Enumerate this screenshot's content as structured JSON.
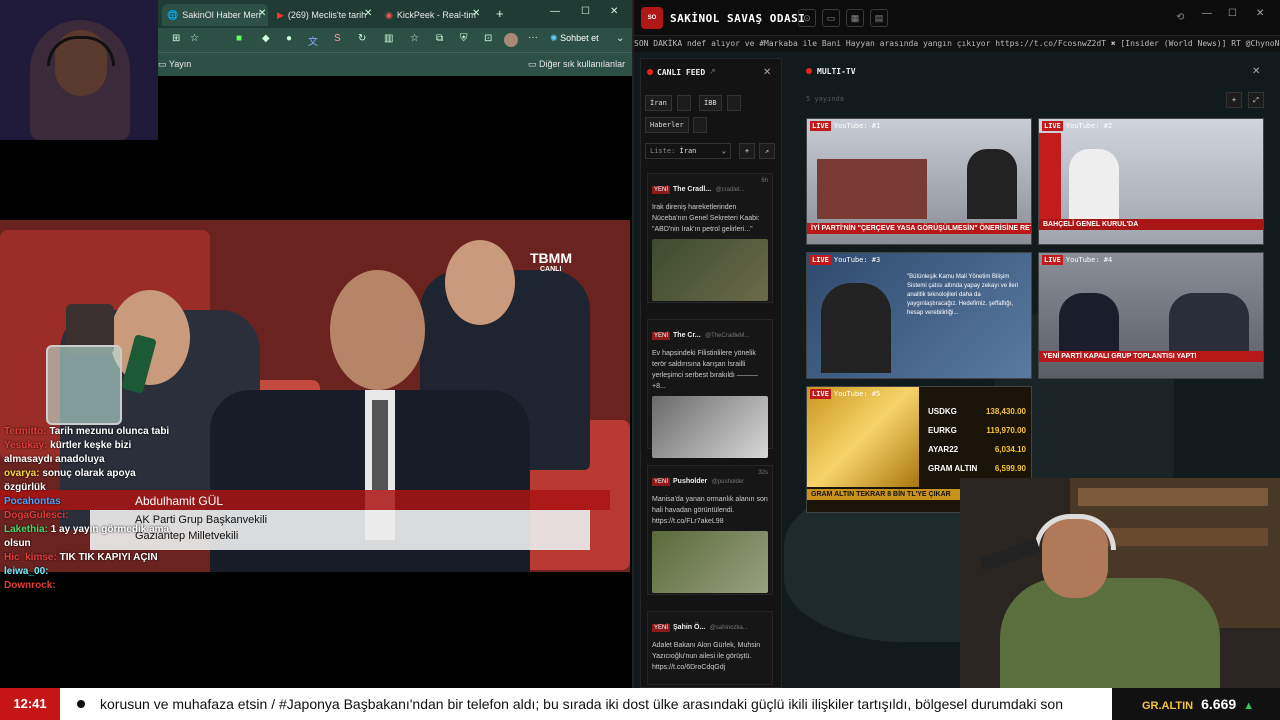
{
  "browser": {
    "tabs": [
      {
        "label": "SakinOl Haber Meri"
      },
      {
        "label": "(269) Meclis'te tarih"
      },
      {
        "label": "KickPeek - Real-tim"
      }
    ],
    "toolbar": {
      "chat_label": "Sohbet et"
    },
    "bookmarks": {
      "item": "Yayın",
      "other": "Diğer sık kullanılanlar"
    }
  },
  "video": {
    "channel": "TBMM",
    "channel_sub": "CANLI",
    "lower_third": {
      "name": "Abdulhamit GÜL",
      "role1": "AK Parti Grup Başkanvekili",
      "role2": "Gaziantep Milletvekili"
    }
  },
  "chat": [
    {
      "user": "Termitto:",
      "text": "Tarih mezunu olunca tabi"
    },
    {
      "user": "Yesukay:",
      "text": "kürtler keşke bizi almasaydı anadoluya"
    },
    {
      "user": "ovarya:",
      "text": "sonuç olarak apoya özgürlük"
    },
    {
      "user": "Pocahontas",
      "text": ""
    },
    {
      "user": "DogaGulesci:",
      "text": ""
    },
    {
      "user": "Lakethia:",
      "text": "1 ay yayın görmedik ama olsun"
    },
    {
      "user": "Hic_kimse:",
      "text": "TIK TIK KAPIYI AÇIN"
    },
    {
      "user": "leiwa_00:",
      "text": ""
    },
    {
      "user": "Downrock:",
      "text": ""
    }
  ],
  "dashboard": {
    "title": "SAKİNOL SAVAŞ ODASI",
    "ticker": "SON DAKİKA  ndef alıyor ve #Markaba ile Bani Hayyan arasında yangın çıkıyor https://t.co/FcosnwZ2dT  ✖  [Insider (World News)] RT @ChynoNews: Temmuz ayında, Ye",
    "feed": {
      "title": "CANLI FEED",
      "chips": [
        "İran",
        "İBB",
        "Haberler"
      ],
      "list_label": "Liste:",
      "list_value": "İran",
      "cards": [
        {
          "badge": "YENİ",
          "author": "The Cradl...",
          "handle": "@cradlet...",
          "time": "6h",
          "text": "Irak direniş hareketlerinden Nüceba'nın Genel Sekreteri Kaabi: \"ABD'nin Irak'ın petrol gelirleri...\""
        },
        {
          "badge": "YENİ",
          "author": "The Cr...",
          "handle": "@TheCradleM...",
          "time": "",
          "text": "Ev hapsindeki Filistinlilere yönelik terör saldırısına karışan İsrailli yerleşimci serbest bırakıldı ——— +8..."
        },
        {
          "badge": "YENİ",
          "author": "Pusholder",
          "handle": "@pusholder",
          "time": "32s",
          "text": "Manisa'da yanan ormanlık alanın son hali havadan görüntülendi. https://t.co/FLr7akeL98"
        },
        {
          "badge": "YENİ",
          "author": "Şahin Ö...",
          "handle": "@sahinozka...",
          "time": "",
          "text": "Adalet Bakanı Alon Gürlek, Muhsin Yazıcıoğlu'nun ailesi ile görüştü. https://t.co/6DroCdqGdj"
        }
      ]
    },
    "multitv": {
      "title": "MULTI-TV",
      "sub": "5 yayında",
      "tiles": [
        {
          "label": "YouTube: #1",
          "strap": "İYİ PARTİ'NİN \"ÇERÇEVE YASA GÖRÜŞÜLMESİN\" ÖNERİSİNE RET"
        },
        {
          "label": "YouTube: #2",
          "strap": "BAHÇELİ GENEL KURUL'DA"
        },
        {
          "label": "YouTube: #3",
          "strap": "\"Bütünleşik Kamu Mali Yönetim Bilişim Sistemi çatısı altında yapay zekayı ve ileri analitik teknolojileri daha da yaygınlaştıracağız. Hedefimiz, şeffaflığı, hesap verebilirliği..."
        },
        {
          "label": "YouTube: #4",
          "strap": "YENİ PARTİ KAPALI GRUP TOPLANTISI YAPTI"
        },
        {
          "label": "YouTube: #5",
          "strap": "GRAM ALTIN TEKRAR 8 BİN TL'YE ÇIKAR"
        }
      ],
      "rates": [
        {
          "name": "USDKG",
          "value": "138,430.00"
        },
        {
          "name": "EURKG",
          "value": "119,970.00"
        },
        {
          "name": "AYAR22",
          "value": "6,034.10"
        },
        {
          "name": "GRAM ALTIN",
          "value": "6,599.90"
        }
      ]
    }
  },
  "bottom_bar": {
    "clock": "12:41",
    "crawl": "korusun ve muhafaza etsin / #Japonya Başbakanı'ndan bir telefon aldı; bu sırada iki dost ülke arasındaki güçlü ikili ilişkiler tartışıldı, bölgesel durumdaki son",
    "gold_label": "GR.ALTIN",
    "gold_value": "6.669",
    "gold_trend": "▲"
  }
}
